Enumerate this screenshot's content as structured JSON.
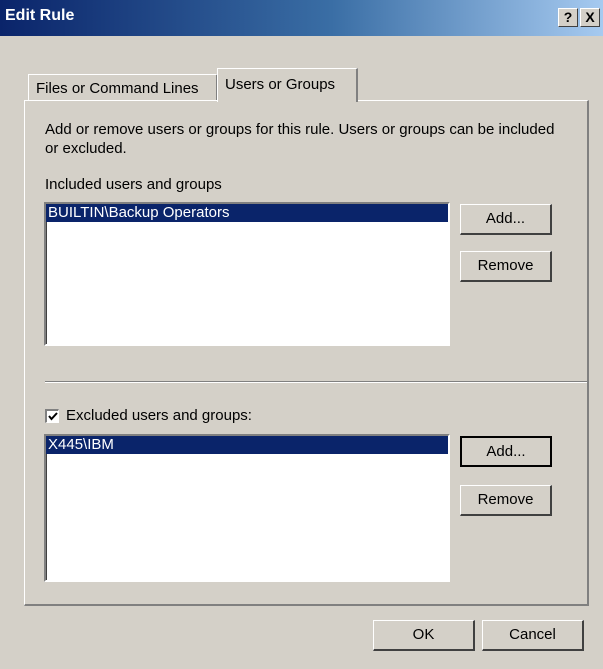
{
  "window": {
    "title": "Edit Rule",
    "help_label": "?",
    "close_label": "X"
  },
  "tabs": [
    {
      "label": "Files or Command Lines"
    },
    {
      "label": "Users or Groups"
    }
  ],
  "panel": {
    "description": "Add or remove users or groups for this rule. Users or groups can be included or excluded.",
    "included": {
      "label": "Included users and groups",
      "items": [
        "BUILTIN\\Backup Operators"
      ],
      "add_label": "Add...",
      "remove_label": "Remove"
    },
    "excluded": {
      "checkbox_checked": true,
      "label": "Excluded users and groups:",
      "items": [
        "X445\\IBM"
      ],
      "add_label": "Add...",
      "remove_label": "Remove"
    }
  },
  "footer": {
    "ok_label": "OK",
    "cancel_label": "Cancel"
  },
  "colors": {
    "title_gradient_start": "#0a246a",
    "title_gradient_end": "#a6caf0",
    "selection": "#0a246a",
    "dialog_face": "#d4d0c8"
  }
}
